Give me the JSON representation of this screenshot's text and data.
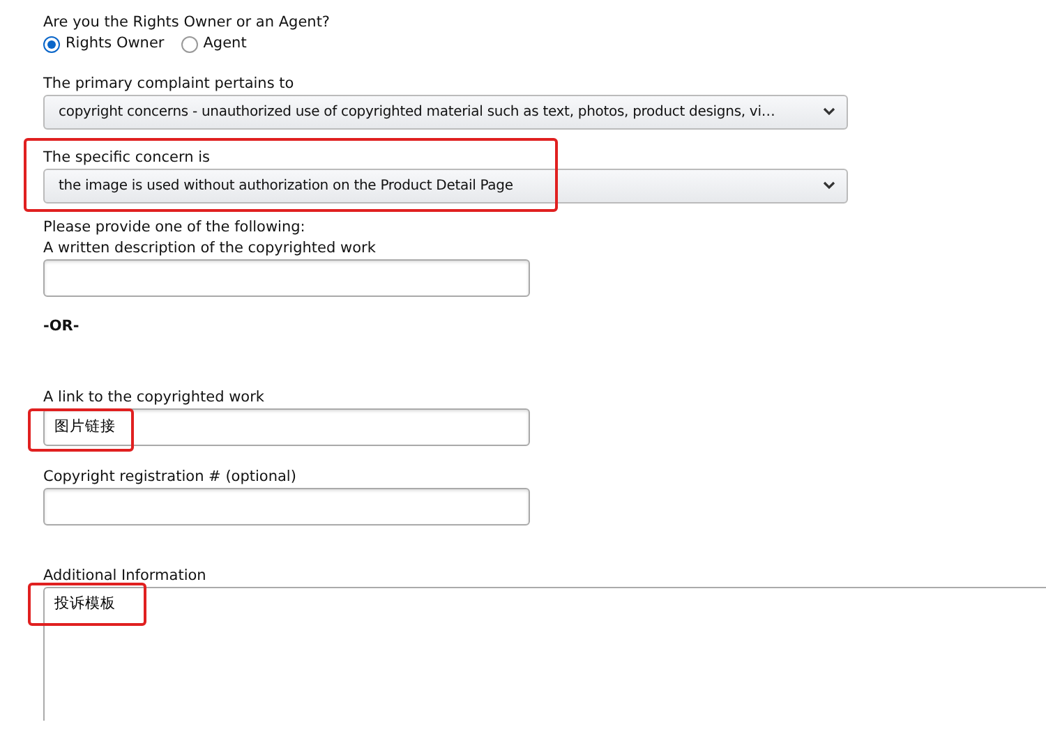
{
  "role_question": {
    "label": "Are you the Rights Owner or an Agent?",
    "options": [
      {
        "label": "Rights Owner",
        "selected": true
      },
      {
        "label": "Agent",
        "selected": false
      }
    ]
  },
  "primary_complaint": {
    "label": "The primary complaint pertains to",
    "value": "copyright concerns - unauthorized use of copyrighted material such as text, photos, product designs, vi…",
    "highlighted": false
  },
  "specific_concern": {
    "label": "The specific concern is",
    "value": "the image is used without authorization on the Product Detail Page",
    "highlighted": true
  },
  "provide_note": "Please provide one of the following:",
  "fields": [
    {
      "kind": "input",
      "label": "A written description of the copyrighted work",
      "highlighted": false
    },
    {
      "kind": "separator",
      "label": "-OR-"
    },
    {
      "kind": "input",
      "label": "A link to the copyrighted work",
      "value": "图片链接",
      "highlighted": true
    },
    {
      "kind": "input",
      "label": "Copyright registration # (optional)",
      "highlighted": false
    },
    {
      "kind": "textarea",
      "label": "Additional Information",
      "value": "投诉模板",
      "highlighted": true
    }
  ]
}
